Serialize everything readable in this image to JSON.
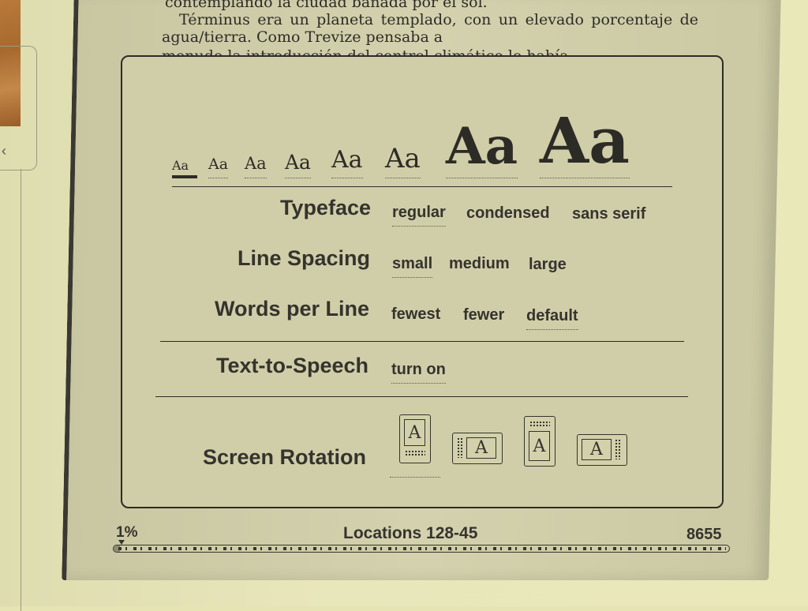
{
  "device": {
    "back_button_icon": "chevron-left-icon"
  },
  "book_text": {
    "line1": "contemplando la ciudad bañada por el sol.",
    "line2": "Términus era un planeta templado, con un elevado porcentaje de agua/tierra. Como Trevize pensaba a",
    "line3": "menudo la introducción del control climático lo había"
  },
  "font_size": {
    "sample": "Aa",
    "levels": 8,
    "selected_level": 1
  },
  "settings": {
    "typeface": {
      "label": "Typeface",
      "options": [
        "regular",
        "condensed",
        "sans serif"
      ],
      "selected": "regular"
    },
    "line_spacing": {
      "label": "Line Spacing",
      "options": [
        "small",
        "medium",
        "large"
      ],
      "selected": "small"
    },
    "words_per_line": {
      "label": "Words per Line",
      "options": [
        "fewest",
        "fewer",
        "default"
      ],
      "selected": "default"
    },
    "text_to_speech": {
      "label": "Text-to-Speech",
      "options": [
        "turn on"
      ],
      "selected": "turn on"
    },
    "screen_rotation": {
      "label": "Screen Rotation",
      "options": [
        "portrait",
        "landscape-left",
        "portrait-inverted",
        "landscape-right"
      ],
      "glyph": "A",
      "selected": "portrait"
    }
  },
  "footer": {
    "percent": "1%",
    "locations": "Locations 128-45",
    "total": "8655",
    "progress_percent": 1
  }
}
